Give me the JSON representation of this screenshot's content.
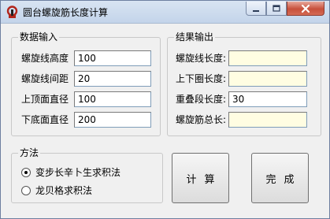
{
  "window": {
    "title": "圆台螺旋筋长度计算",
    "close_symbol": "✕"
  },
  "input_group": {
    "title": "数据输入",
    "fields": [
      {
        "label": "螺旋线高度",
        "value": "100"
      },
      {
        "label": "螺旋线间距",
        "value": "20"
      },
      {
        "label": "上顶面直径",
        "value": "100"
      },
      {
        "label": "下底面直径",
        "value": "200"
      }
    ]
  },
  "output_group": {
    "title": "结果输出",
    "fields": [
      {
        "label": "螺旋线长度:",
        "value": ""
      },
      {
        "label": "上下圈长度:",
        "value": ""
      },
      {
        "label": "重叠段长度:",
        "value": "30"
      },
      {
        "label": "螺旋筋总长:",
        "value": ""
      }
    ]
  },
  "method_group": {
    "title": "方法",
    "options": [
      {
        "label": "变步长辛卜生求积法",
        "checked": true
      },
      {
        "label": "龙贝格求积法",
        "checked": false
      }
    ]
  },
  "buttons": {
    "calculate": "计算",
    "done": "完成"
  }
}
